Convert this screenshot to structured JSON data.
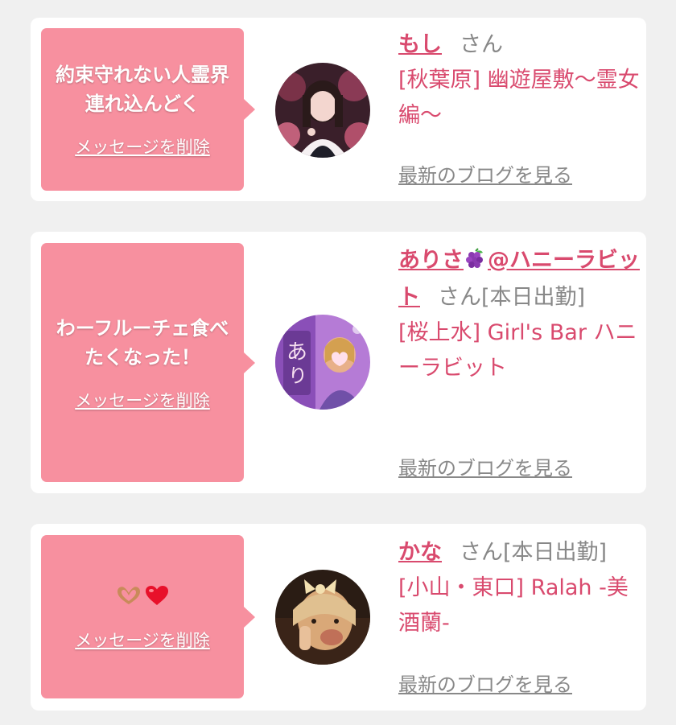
{
  "messages": [
    {
      "bubble_text": "約束守れない人霊界連れ込んどく",
      "delete_label": "メッセージを削除",
      "name": "もし",
      "honorific": "さん",
      "shop": "[秋葉原] 幽遊屋敷〜霊女編〜",
      "blog_link": "最新のブログを見る"
    },
    {
      "bubble_text": "わーフルーチェ食べたくなった！",
      "delete_label": "メッセージを削除",
      "name_prefix": "ありさ",
      "name_emoji": "grape-icon",
      "name_suffix": "@ハニーラビット",
      "honorific": "さん",
      "status": "[本日出勤]",
      "shop": "[桜上水] Girl's Bar ハニーラビット",
      "blog_link": "最新のブログを見る"
    },
    {
      "bubble_icons": [
        "heart-hands-icon",
        "red-heart-icon"
      ],
      "delete_label": "メッセージを削除",
      "name": "かな",
      "honorific": "さん",
      "status": "[本日出勤]",
      "shop": "[小山・東口] Ralah -美酒蘭-",
      "blog_link": "最新のブログを見る"
    }
  ],
  "colors": {
    "page_bg": "#f0f0f0",
    "card_bg": "#ffffff",
    "bubble": "#f7909f",
    "accent": "#d94a6e",
    "muted": "#888888"
  }
}
